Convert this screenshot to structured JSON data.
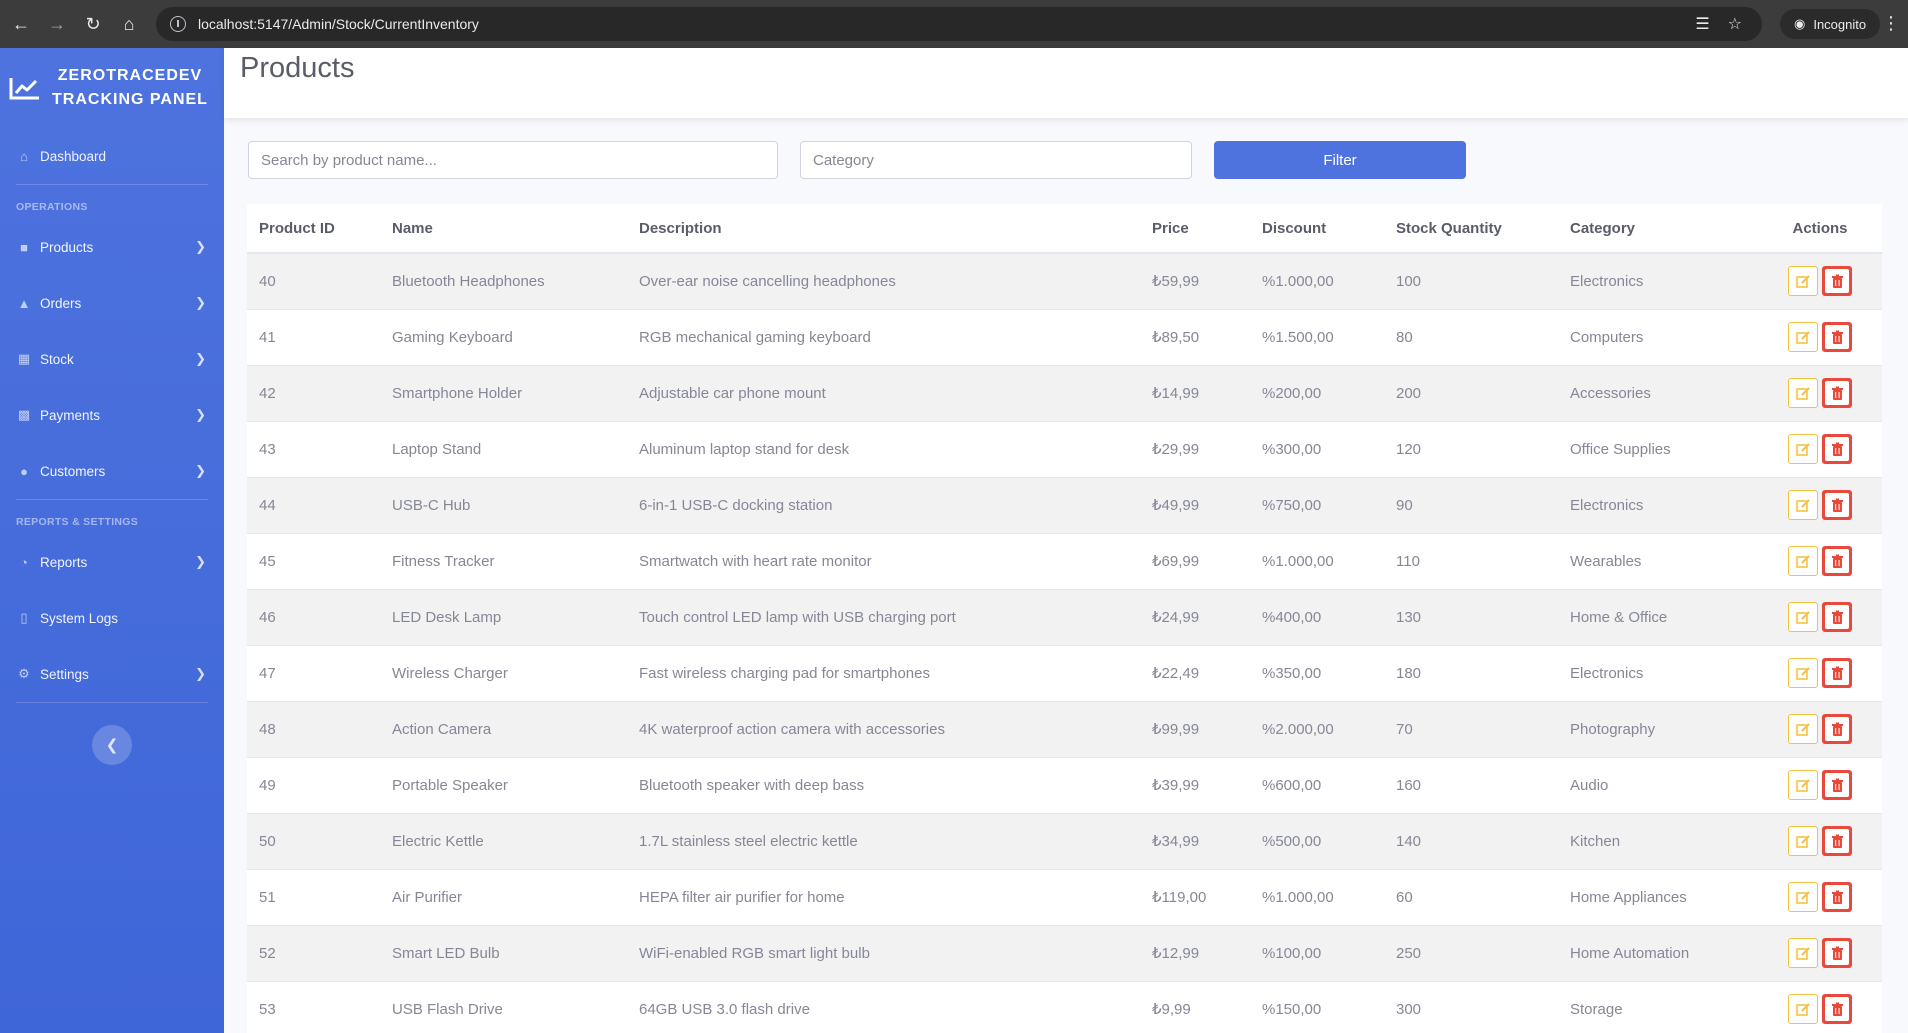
{
  "browser": {
    "url": "localhost:5147/Admin/Stock/CurrentInventory",
    "incognito_label": "Incognito"
  },
  "sidebar": {
    "brand": "ZEROTRACEDEV TRACKING PANEL",
    "dashboard": "Dashboard",
    "heading_operations": "OPERATIONS",
    "products": "Products",
    "orders": "Orders",
    "stock": "Stock",
    "payments": "Payments",
    "customers": "Customers",
    "heading_reports": "REPORTS & SETTINGS",
    "reports": "Reports",
    "system_logs": "System Logs",
    "settings": "Settings"
  },
  "page": {
    "title": "Products"
  },
  "filters": {
    "search_placeholder": "Search by product name...",
    "category_placeholder": "Category",
    "filter_label": "Filter"
  },
  "table": {
    "headers": [
      "Product ID",
      "Name",
      "Description",
      "Price",
      "Discount",
      "Stock Quantity",
      "Category",
      "Actions"
    ],
    "rows": [
      [
        "40",
        "Bluetooth Headphones",
        "Over-ear noise cancelling headphones",
        "₺59,99",
        "%1.000,00",
        "100",
        "Electronics"
      ],
      [
        "41",
        "Gaming Keyboard",
        "RGB mechanical gaming keyboard",
        "₺89,50",
        "%1.500,00",
        "80",
        "Computers"
      ],
      [
        "42",
        "Smartphone Holder",
        "Adjustable car phone mount",
        "₺14,99",
        "%200,00",
        "200",
        "Accessories"
      ],
      [
        "43",
        "Laptop Stand",
        "Aluminum laptop stand for desk",
        "₺29,99",
        "%300,00",
        "120",
        "Office Supplies"
      ],
      [
        "44",
        "USB-C Hub",
        "6-in-1 USB-C docking station",
        "₺49,99",
        "%750,00",
        "90",
        "Electronics"
      ],
      [
        "45",
        "Fitness Tracker",
        "Smartwatch with heart rate monitor",
        "₺69,99",
        "%1.000,00",
        "110",
        "Wearables"
      ],
      [
        "46",
        "LED Desk Lamp",
        "Touch control LED lamp with USB charging port",
        "₺24,99",
        "%400,00",
        "130",
        "Home & Office"
      ],
      [
        "47",
        "Wireless Charger",
        "Fast wireless charging pad for smartphones",
        "₺22,49",
        "%350,00",
        "180",
        "Electronics"
      ],
      [
        "48",
        "Action Camera",
        "4K waterproof action camera with accessories",
        "₺99,99",
        "%2.000,00",
        "70",
        "Photography"
      ],
      [
        "49",
        "Portable Speaker",
        "Bluetooth speaker with deep bass",
        "₺39,99",
        "%600,00",
        "160",
        "Audio"
      ],
      [
        "50",
        "Electric Kettle",
        "1.7L stainless steel electric kettle",
        "₺34,99",
        "%500,00",
        "140",
        "Kitchen"
      ],
      [
        "51",
        "Air Purifier",
        "HEPA filter air purifier for home",
        "₺119,00",
        "%1.000,00",
        "60",
        "Home Appliances"
      ],
      [
        "52",
        "Smart LED Bulb",
        "WiFi-enabled RGB smart light bulb",
        "₺12,99",
        "%100,00",
        "250",
        "Home Automation"
      ],
      [
        "53",
        "USB Flash Drive",
        "64GB USB 3.0 flash drive",
        "₺9,99",
        "%150,00",
        "300",
        "Storage"
      ]
    ]
  },
  "colors": {
    "primary": "#4e73df",
    "warning": "#f6c23e",
    "danger": "#e74a3b"
  }
}
